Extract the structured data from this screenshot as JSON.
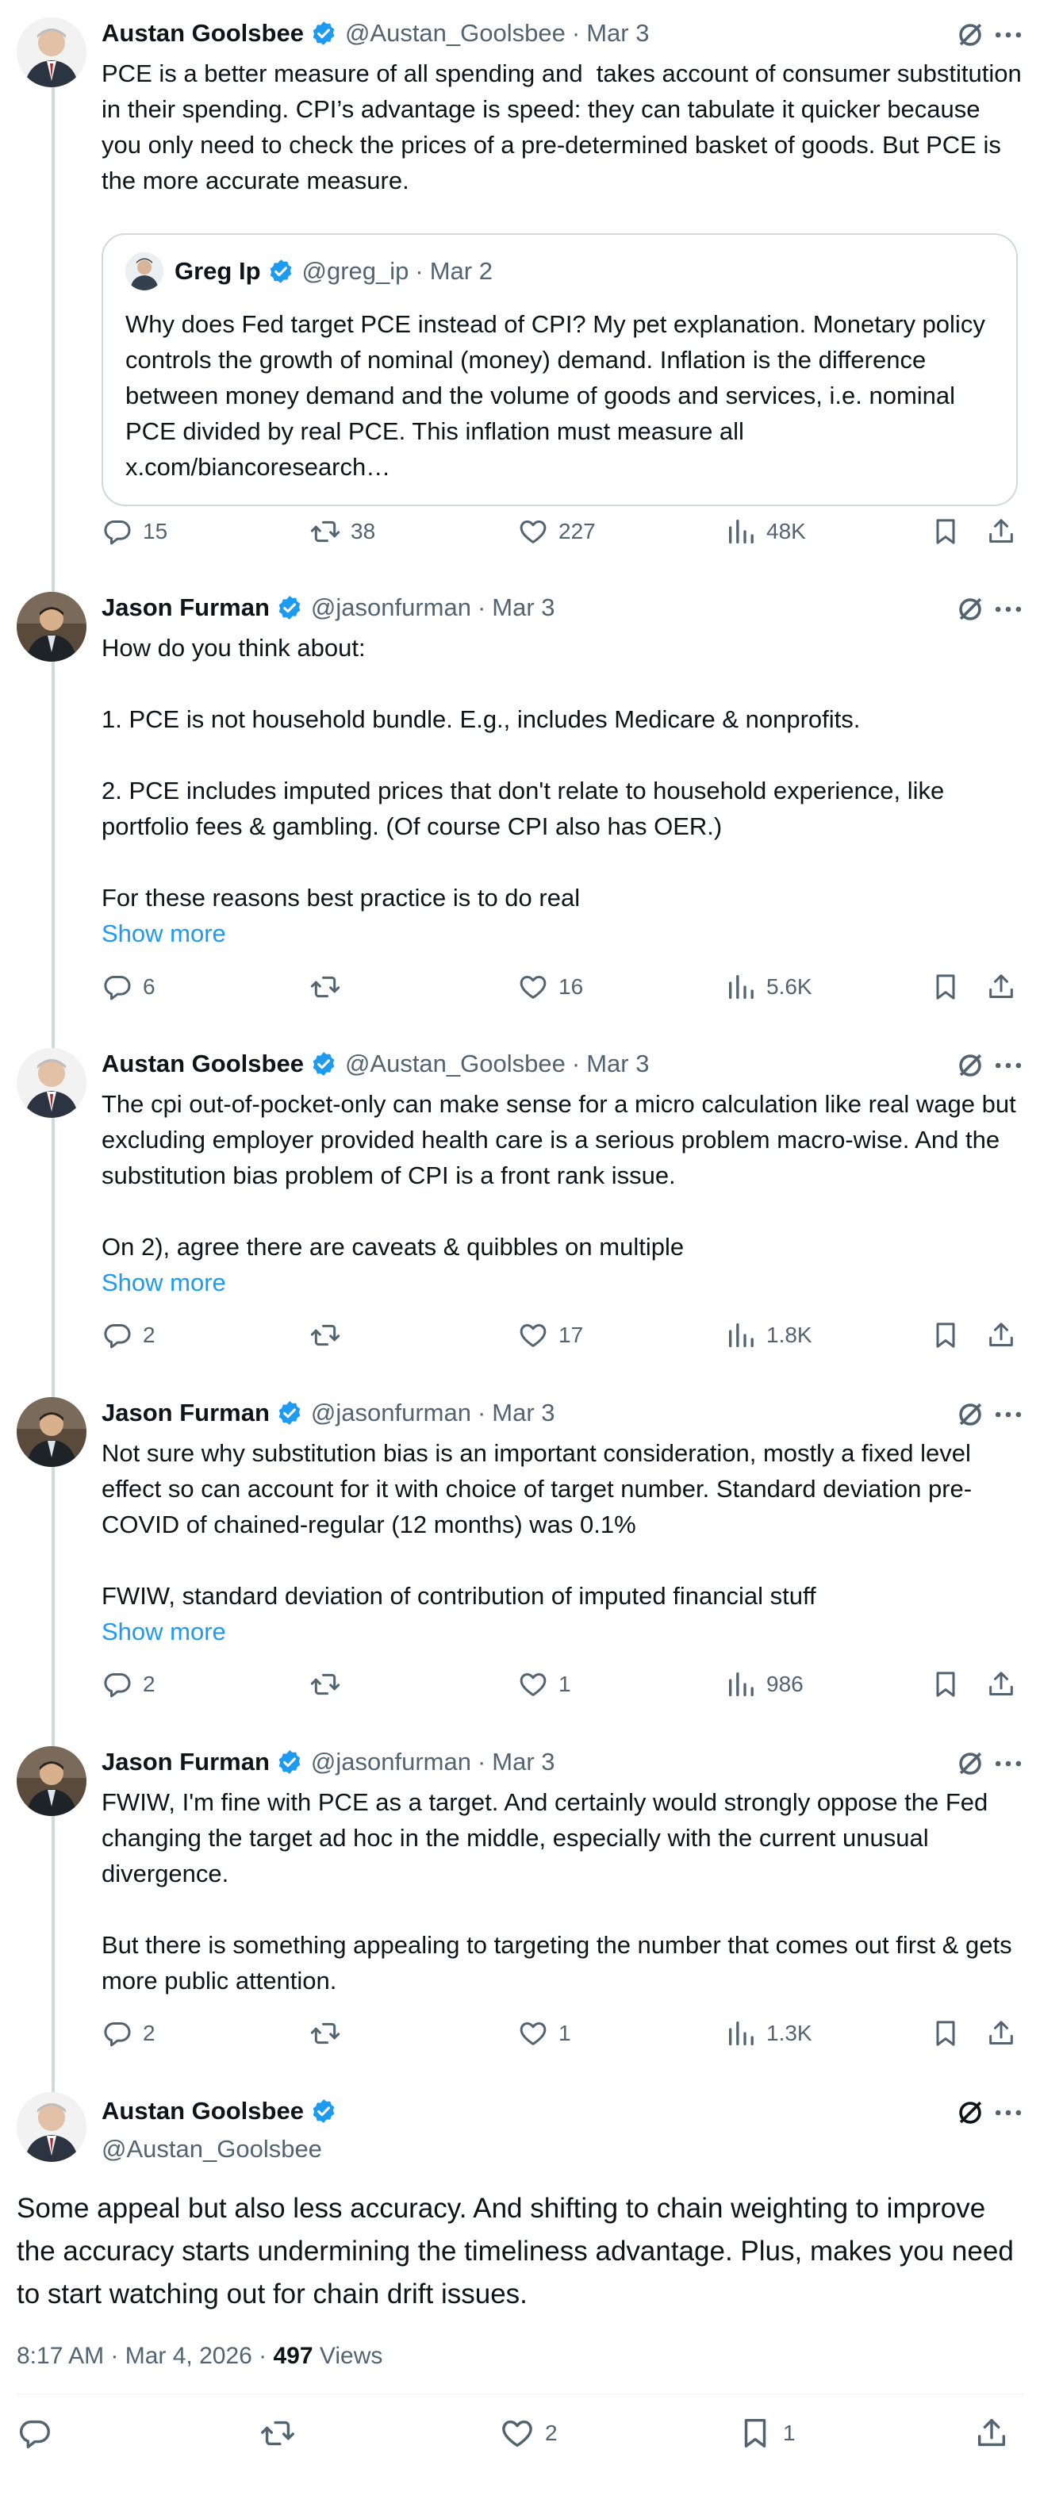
{
  "tweets": [
    {
      "name": "Austan Goolsbee",
      "handle": "@Austan_Goolsbee",
      "dot": "·",
      "date": "Mar 3",
      "text": "PCE is a better measure of all spending and  takes account of consumer substitution in their spending. CPI’s advantage is speed: they can tabulate it quicker because you only need to check the prices of a pre-determined basket of goods. But PCE is the more accurate measure.",
      "quote": {
        "name": "Greg Ip",
        "handle": "@greg_ip",
        "dot": "·",
        "date": "Mar 2",
        "text": "Why does Fed target PCE instead of CPI? My pet explanation. Monetary policy controls the growth of nominal (money) demand. Inflation is the difference between money demand and the volume of goods and services, i.e. nominal PCE divided by real PCE. This inflation must measure all x.com/biancoresearch…"
      },
      "replies": "15",
      "reposts": "38",
      "likes": "227",
      "views": "48K"
    },
    {
      "name": "Jason Furman",
      "handle": "@jasonfurman",
      "dot": "·",
      "date": "Mar 3",
      "text": "How do you think about:\n\n1. PCE is not household bundle. E.g., includes Medicare & nonprofits.\n\n2. PCE includes imputed prices that don't relate to household experience, like portfolio fees & gambling. (Of course CPI also has OER.)\n\nFor these reasons best practice is to do real",
      "show_more": "Show more",
      "replies": "6",
      "reposts": "",
      "likes": "16",
      "views": "5.6K"
    },
    {
      "name": "Austan Goolsbee",
      "handle": "@Austan_Goolsbee",
      "dot": "·",
      "date": "Mar 3",
      "text": "The cpi out-of-pocket-only can make sense for a micro calculation like real wage but excluding employer provided health care is a serious problem macro-wise. And the substitution bias problem of CPI is a front rank issue.\n\nOn 2), agree there are caveats & quibbles on multiple",
      "show_more": "Show more",
      "replies": "2",
      "reposts": "",
      "likes": "17",
      "views": "1.8K"
    },
    {
      "name": "Jason Furman",
      "handle": "@jasonfurman",
      "dot": "·",
      "date": "Mar 3",
      "text": "Not sure why substitution bias is an important consideration, mostly a fixed level effect so can account for it with choice of target number. Standard deviation pre-COVID of chained-regular (12 months) was 0.1%\n\nFWIW, standard deviation of contribution of imputed financial stuff",
      "show_more": "Show more",
      "replies": "2",
      "reposts": "",
      "likes": "1",
      "views": "986"
    },
    {
      "name": "Jason Furman",
      "handle": "@jasonfurman",
      "dot": "·",
      "date": "Mar 3",
      "text": "FWIW, I'm fine with PCE as a target. And certainly would strongly oppose the Fed changing the target ad hoc in the middle, especially with the current unusual divergence.\n\nBut there is something appealing to targeting the number that comes out first & gets more public attention.",
      "replies": "2",
      "reposts": "",
      "likes": "1",
      "views": "1.3K"
    }
  ],
  "main": {
    "name": "Austan Goolsbee",
    "handle": "@Austan_Goolsbee",
    "text": "Some appeal but also less accuracy. And shifting to chain weighting to improve the accuracy starts undermining the timeliness advantage. Plus, makes you need to start watching out for chain drift issues.",
    "time": "8:17 AM · Mar 4, 2026 · ",
    "views_count": "497",
    "views_label": " Views",
    "replies": "",
    "reposts": "",
    "likes": "2",
    "bookmarks": "1"
  },
  "icons": {
    "verified": "verified-badge-icon",
    "grok": "grok-icon",
    "more": "more-dots-icon",
    "reply": "reply-icon",
    "repost": "repost-icon",
    "like": "heart-icon",
    "views": "views-chart-icon",
    "bookmark": "bookmark-icon",
    "share": "share-icon"
  },
  "colors": {
    "accent": "#1d9bf0",
    "muted": "#536471",
    "text": "#0f1419",
    "thread_line": "#cfd9de"
  }
}
